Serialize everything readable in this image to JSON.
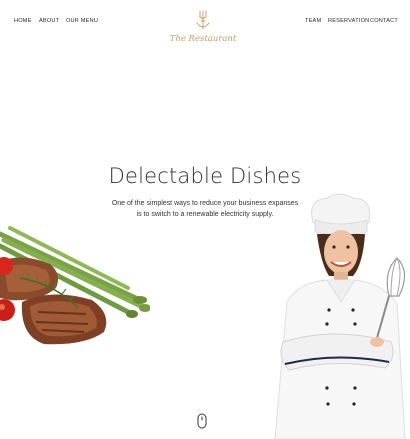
{
  "nav": {
    "left": [
      {
        "label": "HOME"
      },
      {
        "label": "ABOUT"
      },
      {
        "label": "OUR MENU"
      }
    ],
    "right": [
      {
        "label": "TEAM"
      },
      {
        "label": "RESERVATION"
      },
      {
        "label": "CONTACT"
      }
    ]
  },
  "logo": {
    "text": "The Restaurant",
    "icon": "anchor-fork-icon",
    "color": "#c79a66"
  },
  "hero": {
    "title": "Delectable Dishes",
    "subtitle_line1": "One of the simplest ways to reduce your business expanses",
    "subtitle_line2": "is to switch to a renewable electricity supply."
  },
  "images": {
    "food": "steak-asparagus-tomato-image",
    "chef": "smiling-female-chef-with-whisk-image"
  },
  "scroll": {
    "icon": "mouse-scroll-icon"
  }
}
